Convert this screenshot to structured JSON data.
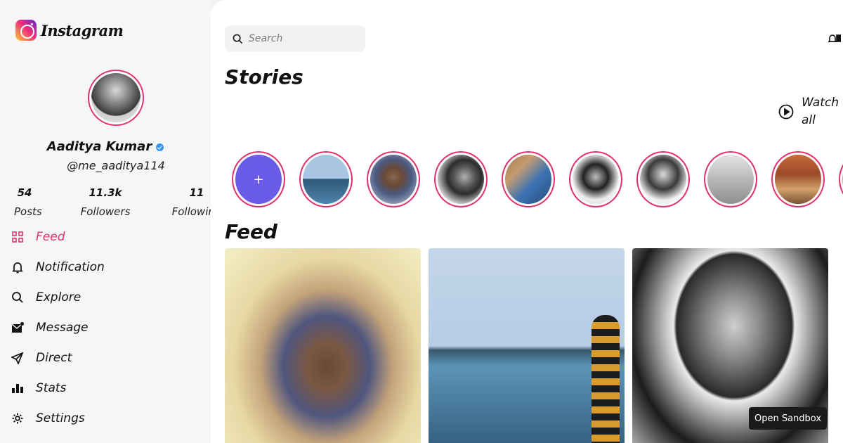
{
  "app": {
    "logo_text": "Instagram"
  },
  "profile": {
    "name": "Aaditya Kumar",
    "handle": "@me_aaditya114"
  },
  "stats": [
    {
      "value": "54",
      "label": "Posts"
    },
    {
      "value": "11.3k",
      "label": "Followers"
    },
    {
      "value": "11",
      "label": "Following"
    }
  ],
  "nav": [
    {
      "label": "Feed",
      "icon": "grid-icon",
      "active": true
    },
    {
      "label": "Notification",
      "icon": "bell-icon"
    },
    {
      "label": "Explore",
      "icon": "search-icon"
    },
    {
      "label": "Message",
      "icon": "mail-icon"
    },
    {
      "label": "Direct",
      "icon": "send-icon"
    },
    {
      "label": "Stats",
      "icon": "bar-chart-icon"
    },
    {
      "label": "Settings",
      "icon": "gear-icon"
    }
  ],
  "search": {
    "placeholder": "Search"
  },
  "stories": {
    "title": "Stories",
    "watch_all": "Watch all",
    "add_label": "+"
  },
  "feed": {
    "title": "Feed"
  },
  "sandbox": {
    "label": "Open Sandbox"
  },
  "colors": {
    "accent": "#e1306c",
    "add_story": "#6b5ce7",
    "verified": "#3897f0",
    "sidebar_bg": "#f6f6f6"
  }
}
